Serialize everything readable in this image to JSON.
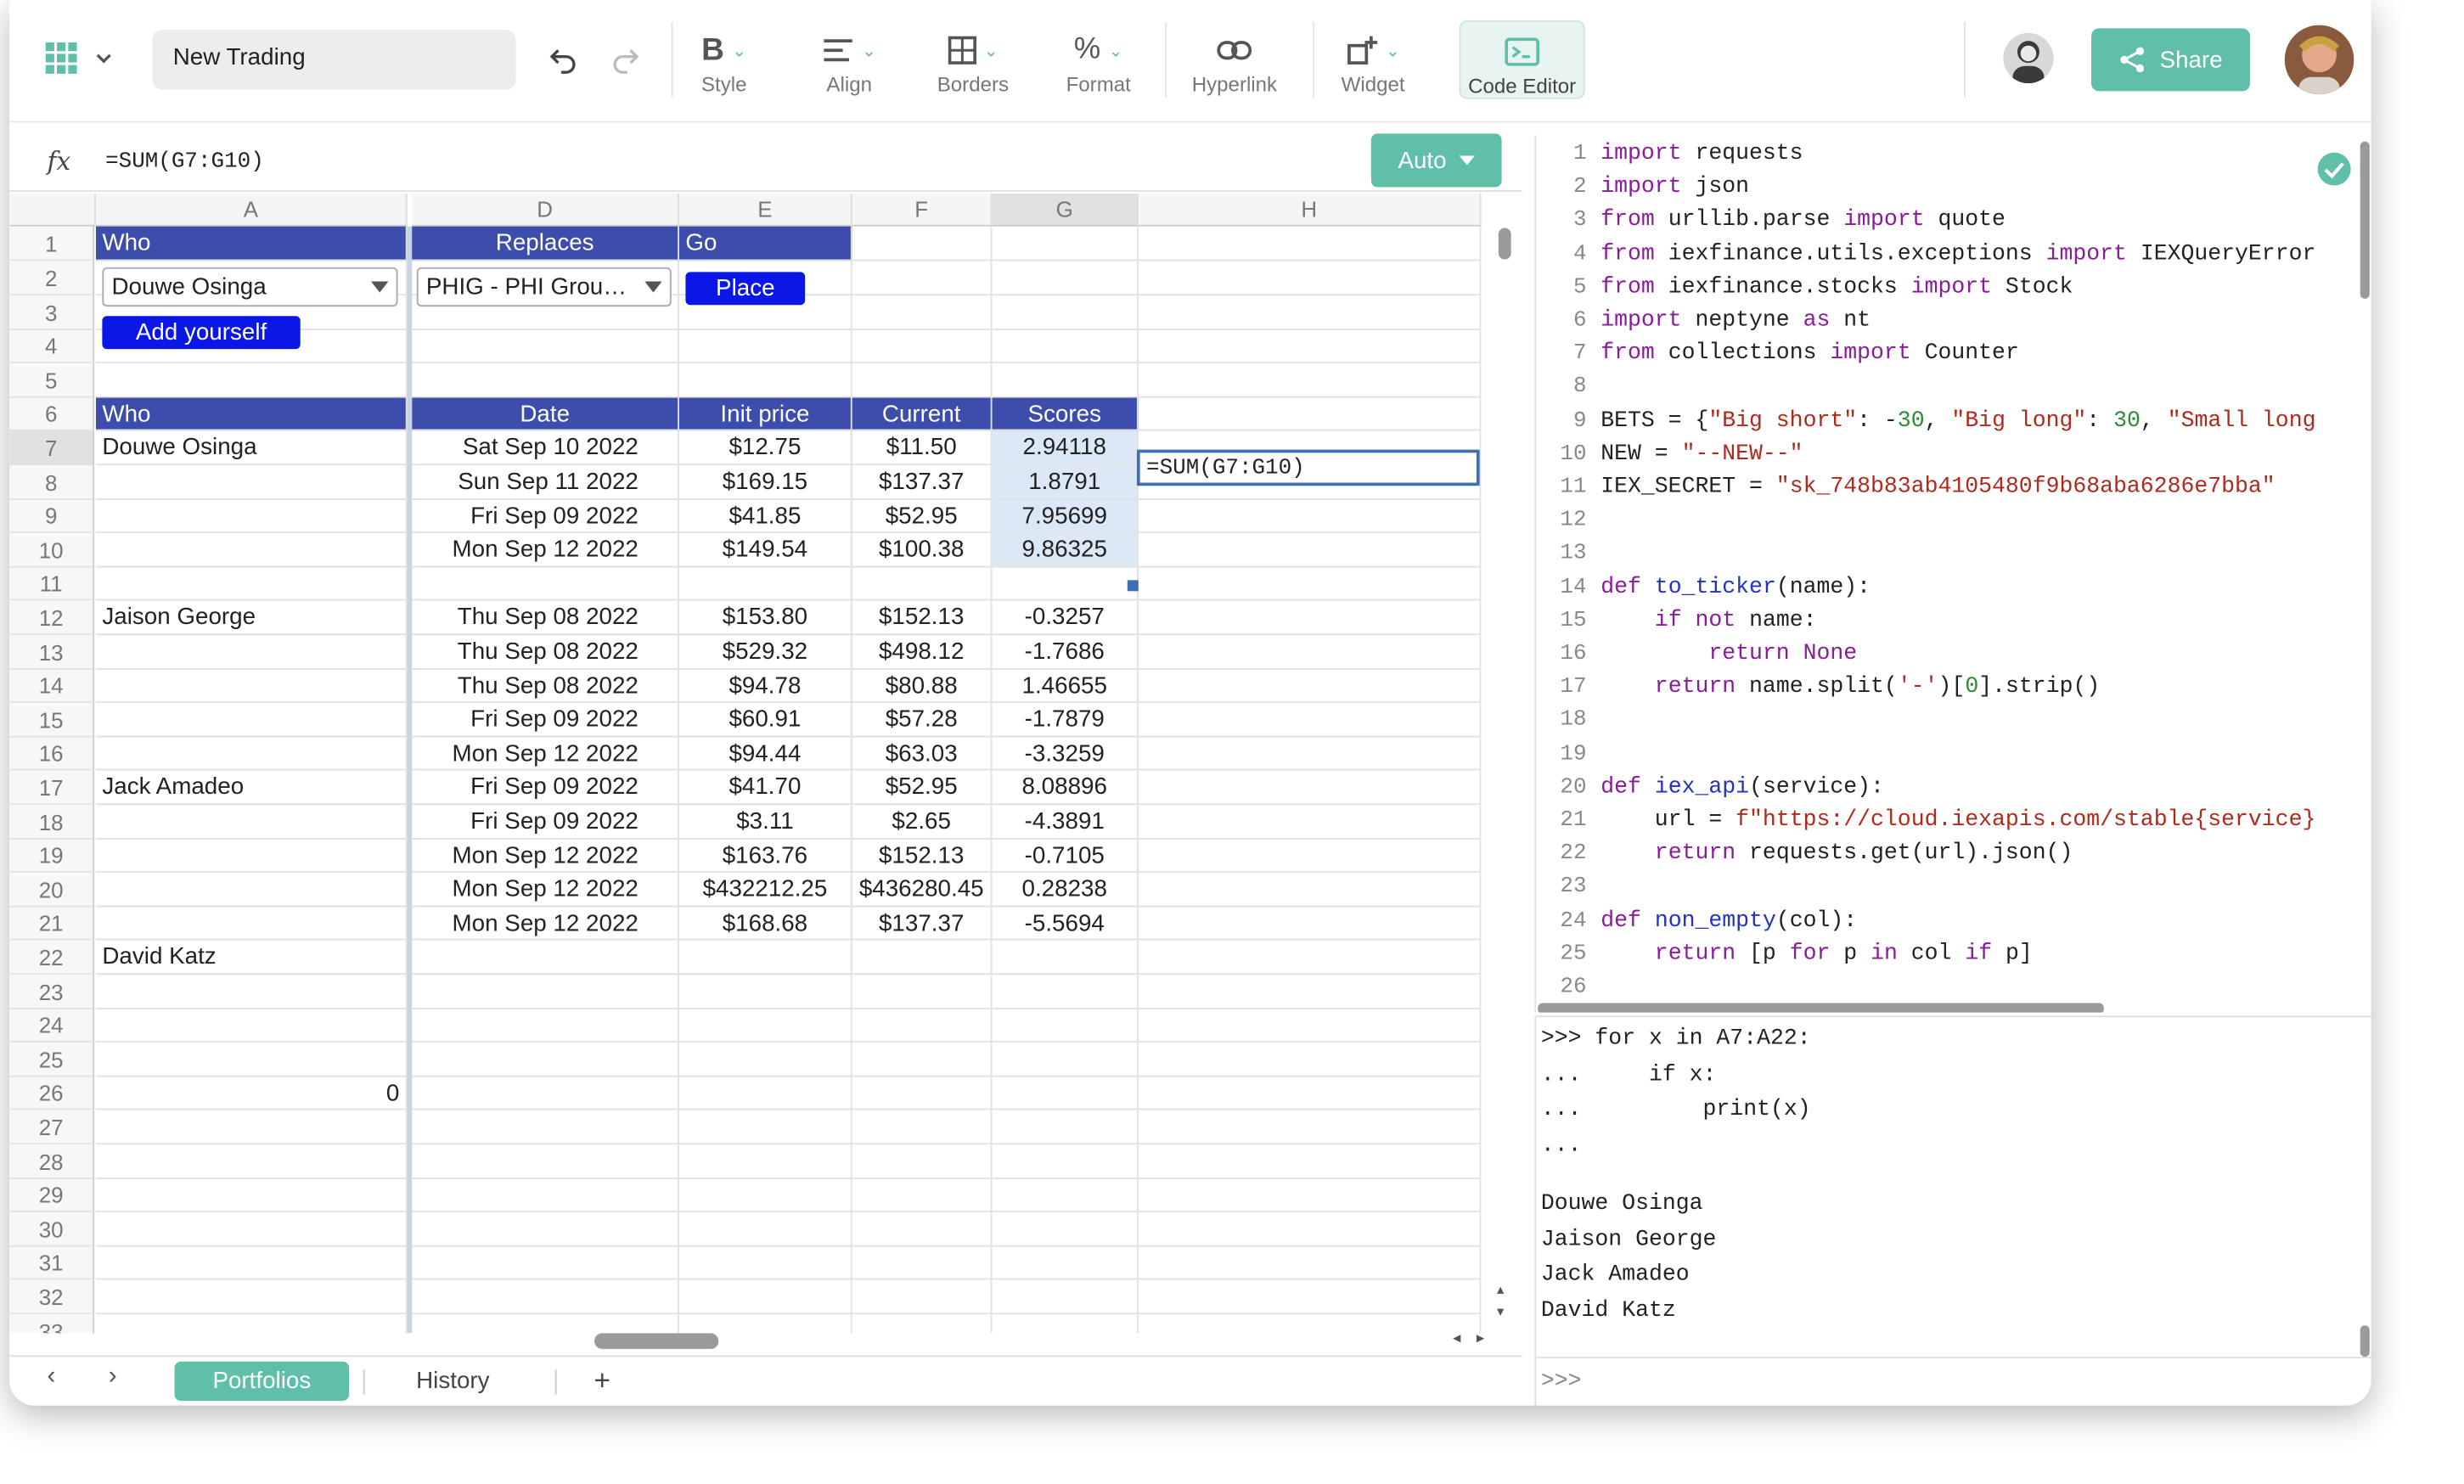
{
  "toolbar": {
    "doc_name": "New Trading",
    "style": "Style",
    "align": "Align",
    "borders": "Borders",
    "format": "Format",
    "hyperlink": "Hyperlink",
    "widget": "Widget",
    "code_editor": "Code Editor",
    "share": "Share"
  },
  "formula_bar": {
    "fx": "fx",
    "formula": "=SUM(G7:G10)",
    "auto": "Auto"
  },
  "columns": [
    "A",
    "D",
    "E",
    "F",
    "G",
    "H"
  ],
  "rows": [
    "1",
    "2",
    "3",
    "4",
    "5",
    "6",
    "7",
    "8",
    "9",
    "10",
    "11",
    "12",
    "13",
    "14",
    "15",
    "16",
    "17",
    "18",
    "19",
    "20",
    "21",
    "22",
    "23",
    "24",
    "25",
    "26",
    "27",
    "28",
    "29",
    "30",
    "31",
    "32",
    "33"
  ],
  "top_section": {
    "who_header": "Who",
    "replaces_header": "Replaces",
    "go_header": "Go",
    "who_value": "Douwe Osinga",
    "replaces_value": "PHIG - PHI Grou…",
    "place_button": "Place",
    "add_yourself_button": "Add yourself"
  },
  "table": {
    "headers": [
      "Who",
      "Date",
      "Init price",
      "Current",
      "Scores"
    ],
    "rows": [
      [
        "Douwe Osinga",
        "Sat Sep 10 2022",
        "$12.75",
        "$11.50",
        "2.94118"
      ],
      [
        "",
        "Sun Sep 11 2022",
        "$169.15",
        "$137.37",
        "1.8791"
      ],
      [
        "",
        "Fri Sep 09 2022",
        "$41.85",
        "$52.95",
        "7.95699"
      ],
      [
        "",
        "Mon Sep 12 2022",
        "$149.54",
        "$100.38",
        "9.86325"
      ],
      [
        "",
        "",
        "",
        "",
        ""
      ],
      [
        "Jaison George",
        "Thu Sep 08 2022",
        "$153.80",
        "$152.13",
        "-0.3257"
      ],
      [
        "",
        "Thu Sep 08 2022",
        "$529.32",
        "$498.12",
        "-1.7686"
      ],
      [
        "",
        "Thu Sep 08 2022",
        "$94.78",
        "$80.88",
        "1.46655"
      ],
      [
        "",
        "Fri Sep 09 2022",
        "$60.91",
        "$57.28",
        "-1.7879"
      ],
      [
        "",
        "Mon Sep 12 2022",
        "$94.44",
        "$63.03",
        "-3.3259"
      ],
      [
        "Jack Amadeo",
        "Fri Sep 09 2022",
        "$41.70",
        "$52.95",
        "8.08896"
      ],
      [
        "",
        "Fri Sep 09 2022",
        "$3.11",
        "$2.65",
        "-4.3891"
      ],
      [
        "",
        "Mon Sep 12 2022",
        "$163.76",
        "$152.13",
        "-0.7105"
      ],
      [
        "",
        "Mon Sep 12 2022",
        "$432212.25",
        "$436280.45",
        "0.28238"
      ],
      [
        "",
        "Mon Sep 12 2022",
        "$168.68",
        "$137.37",
        "-5.5694"
      ],
      [
        "David Katz",
        "",
        "",
        "",
        ""
      ]
    ],
    "a26_value": "0"
  },
  "active_cell": {
    "text": "=SUM(G7:G10)"
  },
  "tabs": {
    "portfolios": "Portfolios",
    "history": "History",
    "add": "+"
  },
  "code_lines": [
    "import requests",
    "import json",
    "from urllib.parse import quote",
    "from iexfinance.utils.exceptions import IEXQueryError",
    "from iexfinance.stocks import Stock",
    "import neptyne as nt",
    "from collections import Counter",
    "",
    "BETS = {\"Big short\": -30, \"Big long\": 30, \"Small long",
    "NEW = \"--NEW--\"",
    "IEX_SECRET = \"sk_748b83ab4105480f9b68aba6286e7bba\"",
    "",
    "",
    "def to_ticker(name):",
    "    if not name:",
    "        return None",
    "    return name.split('-')[0].strip()",
    "",
    "",
    "def iex_api(service):",
    "    url = f\"https://cloud.iexapis.com/stable{service}",
    "    return requests.get(url).json()",
    "",
    "def non_empty(col):",
    "    return [p for p in col if p]",
    ""
  ],
  "console": {
    "input_lines": [
      ">>> for x in A7:A22:",
      "...     if x:",
      "...         print(x)",
      "..."
    ],
    "output": [
      "Douwe Osinga",
      "Jaison George",
      "Jack Amadeo",
      "David Katz"
    ],
    "prompt": ">>>"
  },
  "colors": {
    "accent": "#5fbfa9",
    "header": "#3d4dab",
    "button_blue": "#0a17e6"
  }
}
